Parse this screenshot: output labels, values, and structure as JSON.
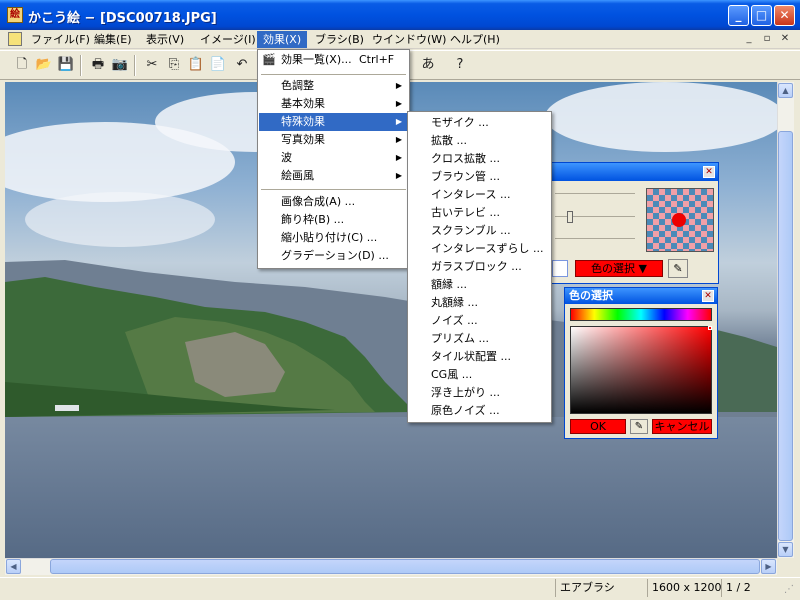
{
  "window": {
    "title": "かこう絵 − [DSC00718.JPG]"
  },
  "menubar": {
    "items": [
      {
        "label": "ファイル(F)"
      },
      {
        "label": "編集(E)"
      },
      {
        "label": "表示(V)"
      },
      {
        "label": "イメージ(I)"
      },
      {
        "label": "効果(X)"
      },
      {
        "label": "ブラシ(B)"
      },
      {
        "label": "ウインドウ(W)"
      },
      {
        "label": "ヘルプ(H)"
      }
    ]
  },
  "effects_menu": {
    "header": {
      "label": "効果一覧(X)...",
      "shortcut": "Ctrl+F"
    },
    "group1": [
      {
        "label": "色調整"
      },
      {
        "label": "基本効果"
      },
      {
        "label": "特殊効果"
      },
      {
        "label": "写真効果"
      },
      {
        "label": "波"
      },
      {
        "label": "絵画風"
      }
    ],
    "group2": [
      {
        "label": "画像合成(A) ..."
      },
      {
        "label": "飾り枠(B) ..."
      },
      {
        "label": "縮小貼り付け(C) ..."
      },
      {
        "label": "グラデーション(D) ..."
      }
    ]
  },
  "special_menu": {
    "items": [
      {
        "label": "モザイク ..."
      },
      {
        "label": "拡散 ..."
      },
      {
        "label": "クロス拡散 ..."
      },
      {
        "label": "ブラウン管 ..."
      },
      {
        "label": "インタレース ..."
      },
      {
        "label": "古いテレビ ..."
      },
      {
        "label": "スクランブル ..."
      },
      {
        "label": "インタレースずらし ..."
      },
      {
        "label": "ガラスブロック ..."
      },
      {
        "label": "額縁 ..."
      },
      {
        "label": "丸額縁 ..."
      },
      {
        "label": "ノイズ ..."
      },
      {
        "label": "プリズム ..."
      },
      {
        "label": "タイル状配置 ..."
      },
      {
        "label": "CG風 ..."
      },
      {
        "label": "浮き上がり ..."
      },
      {
        "label": "原色ノイズ ..."
      }
    ]
  },
  "brush_palette": {
    "color_select_label": "色の選択 ▼"
  },
  "color_dialog": {
    "title": "色の選択",
    "ok_label": "OK",
    "cancel_label": "キャンセル"
  },
  "statusbar": {
    "brush": "エアブラシ",
    "size": "1600 x 1200",
    "page": "1 / 2"
  },
  "colors": {
    "titlebar": "#0052e0",
    "highlight": "#316ac5",
    "brush_color": "#ff0000"
  }
}
